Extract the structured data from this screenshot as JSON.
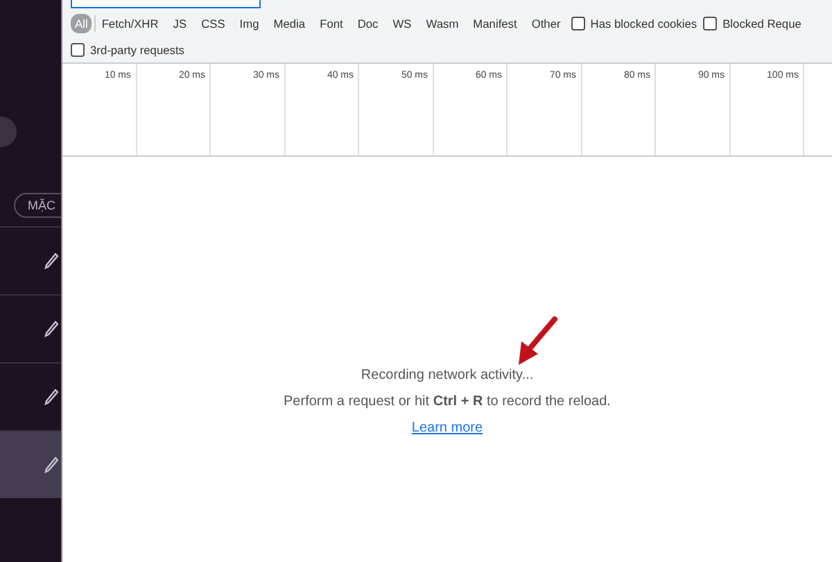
{
  "sidebar": {
    "chip": "MẶC",
    "items": [
      {
        "selected": false
      },
      {
        "selected": false
      },
      {
        "selected": false
      },
      {
        "selected": true
      }
    ]
  },
  "filters": [
    {
      "label": "All",
      "selected": true
    },
    {
      "label": "Fetch/XHR",
      "selected": false
    },
    {
      "label": "JS",
      "selected": false
    },
    {
      "label": "CSS",
      "selected": false
    },
    {
      "label": "Img",
      "selected": false
    },
    {
      "label": "Media",
      "selected": false
    },
    {
      "label": "Font",
      "selected": false
    },
    {
      "label": "Doc",
      "selected": false
    },
    {
      "label": "WS",
      "selected": false
    },
    {
      "label": "Wasm",
      "selected": false
    },
    {
      "label": "Manifest",
      "selected": false
    },
    {
      "label": "Other",
      "selected": false
    }
  ],
  "filter_checkboxes": [
    {
      "label": "Has blocked cookies",
      "checked": false
    },
    {
      "label": "Blocked Reque",
      "checked": false
    }
  ],
  "third_party": {
    "label": "3rd-party requests",
    "checked": false
  },
  "timeline": {
    "ticks": [
      "10 ms",
      "20 ms",
      "30 ms",
      "40 ms",
      "50 ms",
      "60 ms",
      "70 ms",
      "80 ms",
      "90 ms",
      "100 ms"
    ]
  },
  "empty_state": {
    "title": "Recording network activity...",
    "hint": "Perform a request or hit **Ctrl + R** to record the reload.",
    "link": "Learn more"
  }
}
